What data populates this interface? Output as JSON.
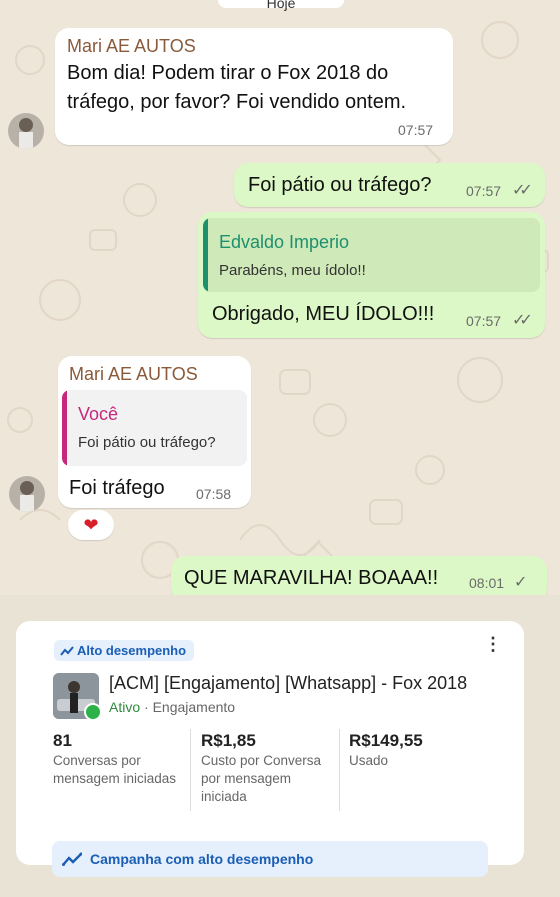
{
  "date_pill": "Hoje",
  "messages": [
    {
      "sender": "Mari AE AUTOS",
      "line1": "Bom dia! Podem tirar o Fox 2018 do",
      "line2": "tráfego, por favor? Foi vendido ontem.",
      "time": "07:57"
    },
    {
      "text": "Foi pátio ou tráfego?",
      "time": "07:57",
      "ticks": "✓✓"
    },
    {
      "quote_name": "Edvaldo Imperio",
      "quote_text": "Parabéns, meu ídolo!!",
      "text": "Obrigado, MEU ÍDOLO!!!",
      "time": "07:57",
      "ticks": "✓✓"
    },
    {
      "sender": "Mari AE AUTOS",
      "quote_name": "Você",
      "quote_text": "Foi pátio ou tráfego?",
      "text": "Foi tráfego",
      "time": "07:58",
      "reaction": "❤"
    },
    {
      "text": "QUE MARAVILHA! BOAAA!!",
      "time": "08:01",
      "ticks": "✓"
    }
  ],
  "card": {
    "badge": "Alto desempenho",
    "more_icon": "⋮",
    "campaign": "[ACM] [Engajamento] [Whatsapp] - Fox 2018",
    "status": "Ativo",
    "objective": "· Engajamento",
    "metrics": [
      {
        "value": "81",
        "label1": "Conversas por",
        "label2": "mensagem iniciadas",
        "label3": ""
      },
      {
        "value": "R$1,85",
        "label1": "Custo por Conversa",
        "label2": "por mensagem",
        "label3": "iniciada"
      },
      {
        "value": "R$149,55",
        "label1": "Usado",
        "label2": "",
        "label3": ""
      }
    ],
    "banner": "Campanha com alto desempenho"
  },
  "colors": {
    "outgoing": "#dcf8c6",
    "incoming": "#ffffff",
    "accent_blue": "#1a5fb4",
    "active_green": "#2db24a"
  }
}
